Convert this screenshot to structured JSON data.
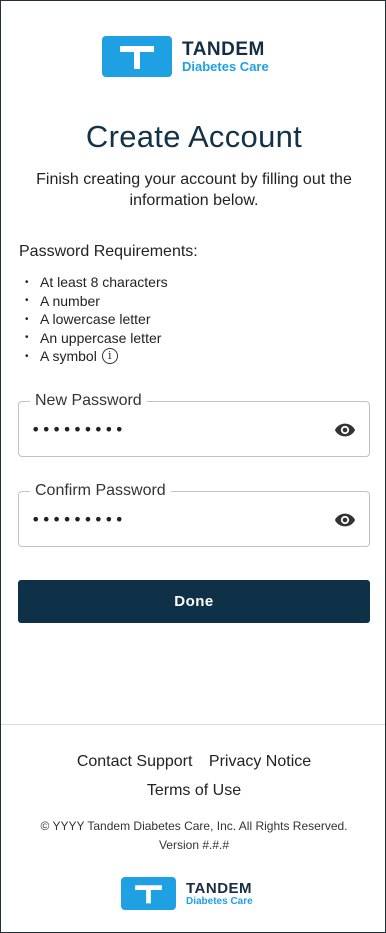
{
  "brand": {
    "name": "TANDEM",
    "subtitle": "Diabetes Care",
    "primary_color": "#1fa0e3",
    "dark_color": "#162d43"
  },
  "header": {
    "title": "Create Account",
    "subtitle": "Finish creating your account by filling out the information below."
  },
  "requirements": {
    "title": "Password Requirements:",
    "items": [
      "At least 8 characters",
      "A number",
      "A lowercase letter",
      "An uppercase letter",
      "A symbol"
    ],
    "info_icon": "info-icon"
  },
  "form": {
    "new_password": {
      "label": "New Password",
      "value": "•••••••••",
      "icon": "eye-icon"
    },
    "confirm_password": {
      "label": "Confirm Password",
      "value": "•••••••••",
      "icon": "eye-icon"
    },
    "done_label": "Done",
    "button_color": "#0e3148"
  },
  "footer": {
    "contact_support": "Contact Support",
    "privacy_notice": "Privacy Notice",
    "terms_of_use": "Terms of Use",
    "copyright": "© YYYY Tandem Diabetes Care, Inc. All Rights Reserved.",
    "version": "Version #.#.#"
  }
}
